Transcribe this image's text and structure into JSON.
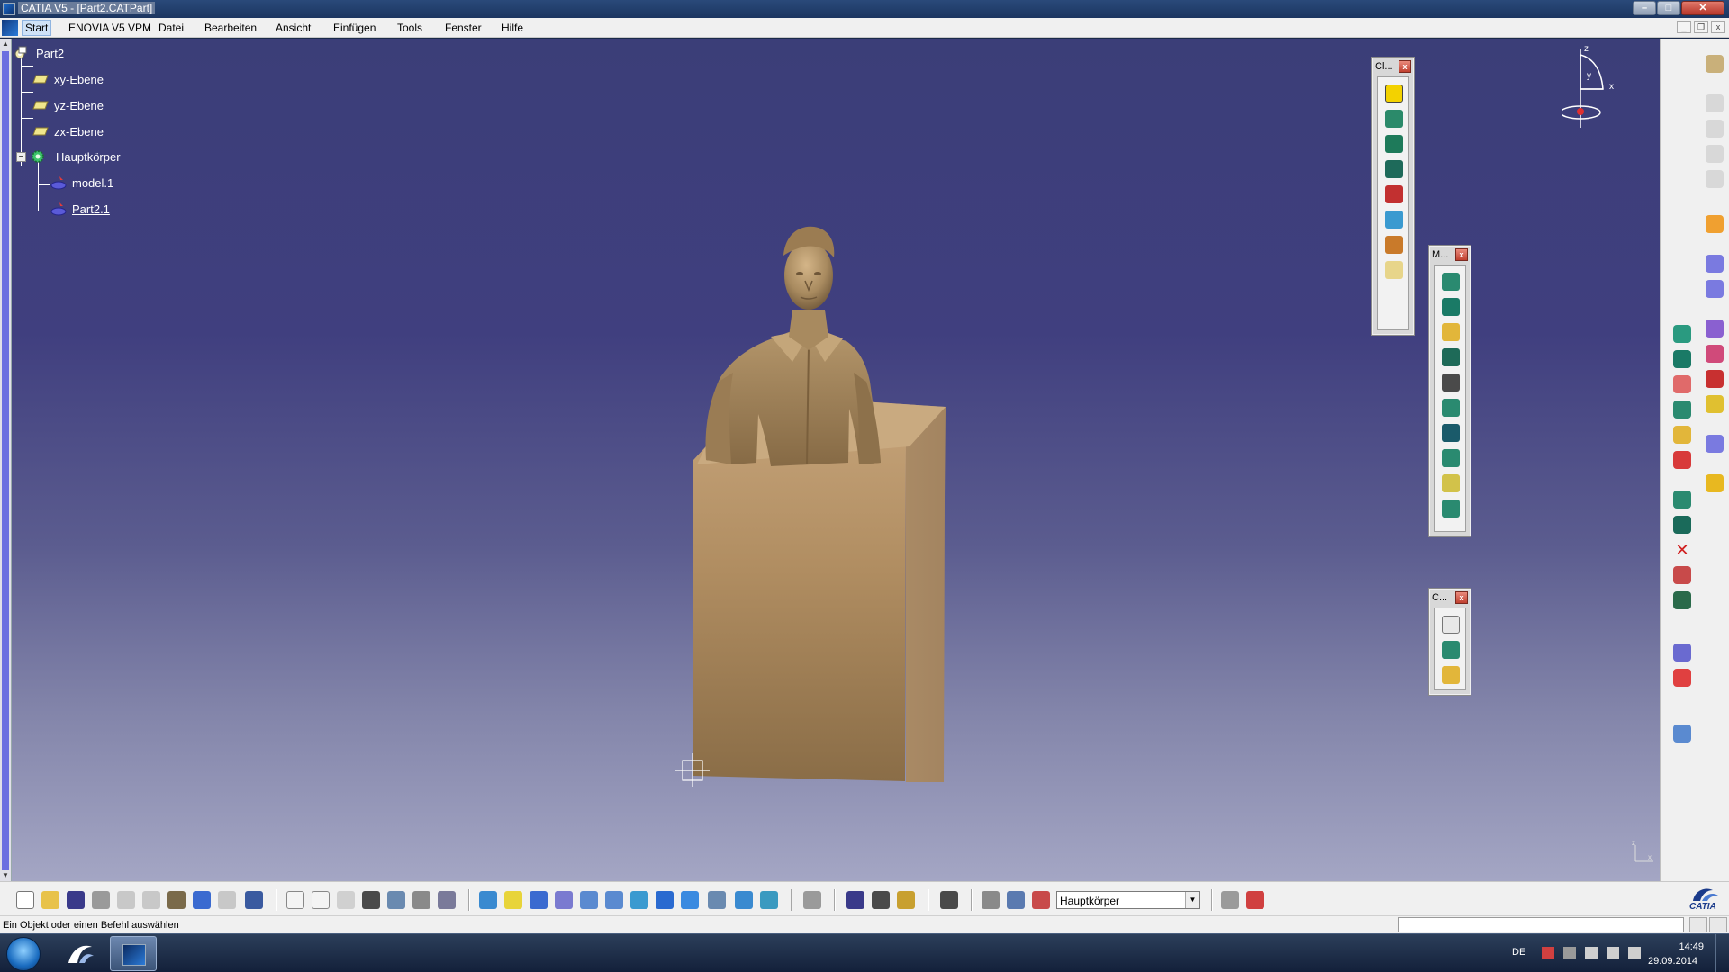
{
  "window": {
    "title": "CATIA V5 - [Part2.CATPart]",
    "min_label": "–",
    "max_label": "□",
    "close_label": "✕"
  },
  "menu": {
    "items": [
      "Start",
      "ENOVIA V5 VPM",
      "Datei",
      "Bearbeiten",
      "Ansicht",
      "Einfügen",
      "Tools",
      "Fenster",
      "Hilfe"
    ],
    "mdi_min": "_",
    "mdi_restore": "❐",
    "mdi_close": "x"
  },
  "tree": {
    "root": "Part2",
    "planes": [
      "xy-Ebene",
      "yz-Ebene",
      "zx-Ebene"
    ],
    "body": "Hauptkörper",
    "children": [
      "model.1",
      "Part2.1"
    ],
    "expander": "−"
  },
  "compass": {
    "x": "x",
    "y": "y",
    "z": "z"
  },
  "mini_axis": {
    "z": "z",
    "x": "x"
  },
  "floating_toolbars": [
    {
      "title": "Cl...",
      "close": "x"
    },
    {
      "title": "M...",
      "close": "x"
    },
    {
      "title": "C...",
      "close": "x"
    }
  ],
  "bottom_toolbar": {
    "active_body": "Hauptkörper",
    "dropdown_arrow": "▼",
    "logo_text": "CATIA"
  },
  "status": {
    "message": "Ein Objekt oder einen Befehl auswählen",
    "command_value": ""
  },
  "taskbar": {
    "language": "DE",
    "time": "14:49",
    "date": "29.09.2014"
  },
  "colors": {
    "viewport_top": "#3b3e78",
    "viewport_bottom": "#a4a6c4",
    "model_color": "#b8996a",
    "tree_text": "#ffffff"
  }
}
